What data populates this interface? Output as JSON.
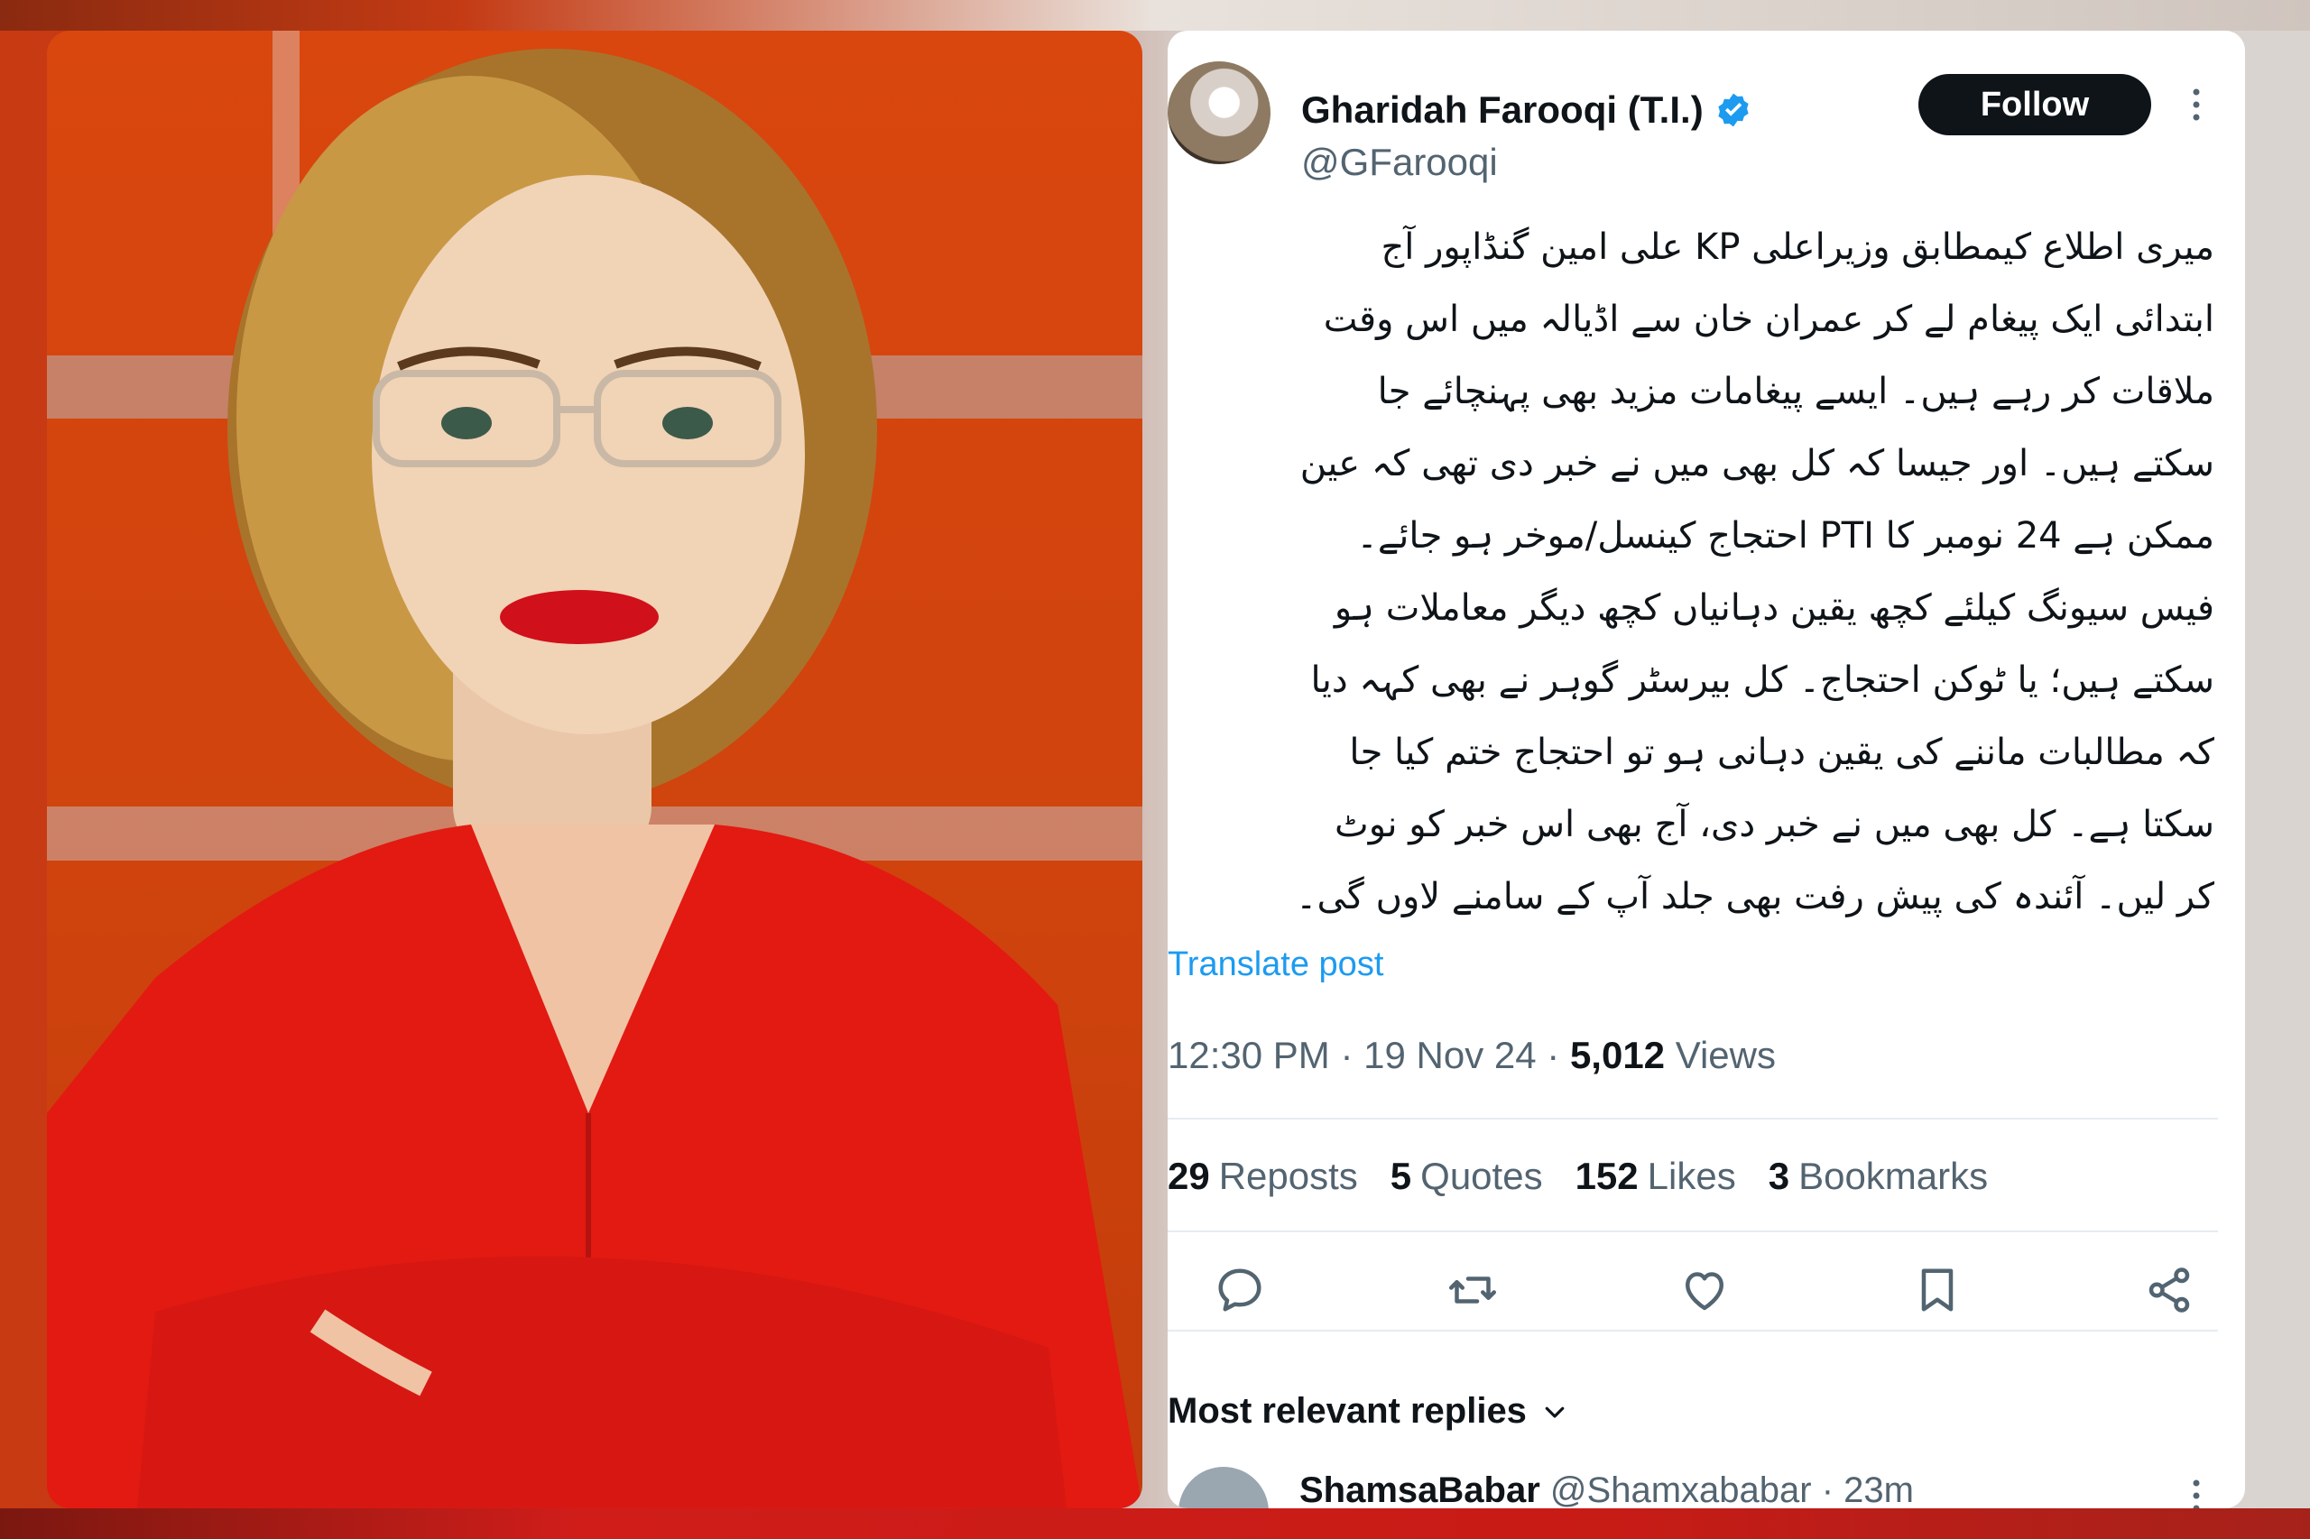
{
  "tweet": {
    "author_name": "Gharidah Farooqi (T.I.)",
    "author_handle": "@GFarooqi",
    "follow_label": "Follow",
    "lines": [
      "میری اطلاع کیمطابق وزیراعلی KP علی امین گنڈاپور آج",
      "ابتدائی ایک پیغام لے کر عمران خان سے اڈیالہ میں اس وقت",
      "ملاقات کر رہے ہیں۔ ایسے پیغامات مزید بھی پہنچائے جا",
      "سکتے ہیں۔ اور جیسا کہ کل بھی میں نے خبر دی تھی کہ عین",
      "ممکن ہے 24 نومبر کا PTI احتجاج کینسل/موخر ہو جائے۔",
      "فیس سیونگ کیلئے کچھ یقین دہانیاں کچھ دیگر معاملات ہو",
      "سکتے ہیں؛ یا ٹوکن احتجاج۔ کل بیرسٹر گوہر نے بھی کہہ دیا",
      "کہ مطالبات ماننے کی یقین دہانی ہو تو احتجاج ختم کیا جا",
      "سکتا ہے۔ کل بھی میں نے خبر دی، آج بھی اس خبر کو نوٹ",
      "کر لیں۔ آئندہ کی پیش رفت بھی جلد آپ کے سامنے لاوں گی۔"
    ],
    "translate_label": "Translate post",
    "time": "12:30 PM",
    "date": "19 Nov 24",
    "views_count": "5,012",
    "views_label": "Views",
    "separator": "·",
    "stats": {
      "reposts_count": "29",
      "reposts_label": "Reposts",
      "quotes_count": "5",
      "quotes_label": "Quotes",
      "likes_count": "152",
      "likes_label": "Likes",
      "bookmarks_count": "3",
      "bookmarks_label": "Bookmarks"
    },
    "action_icons": [
      "reply-icon",
      "repost-icon",
      "like-icon",
      "bookmark-icon",
      "share-icon"
    ]
  },
  "replies": {
    "header_label": "Most relevant replies",
    "first": {
      "name": "ShamsaBabar",
      "handle": "@Shamxababar",
      "age": "23m"
    }
  },
  "colors": {
    "accent": "#1d9bf0",
    "text": "#0f1419",
    "secondary": "#536471",
    "follow_bg": "#0f1419",
    "divider": "#e6ecf0"
  }
}
